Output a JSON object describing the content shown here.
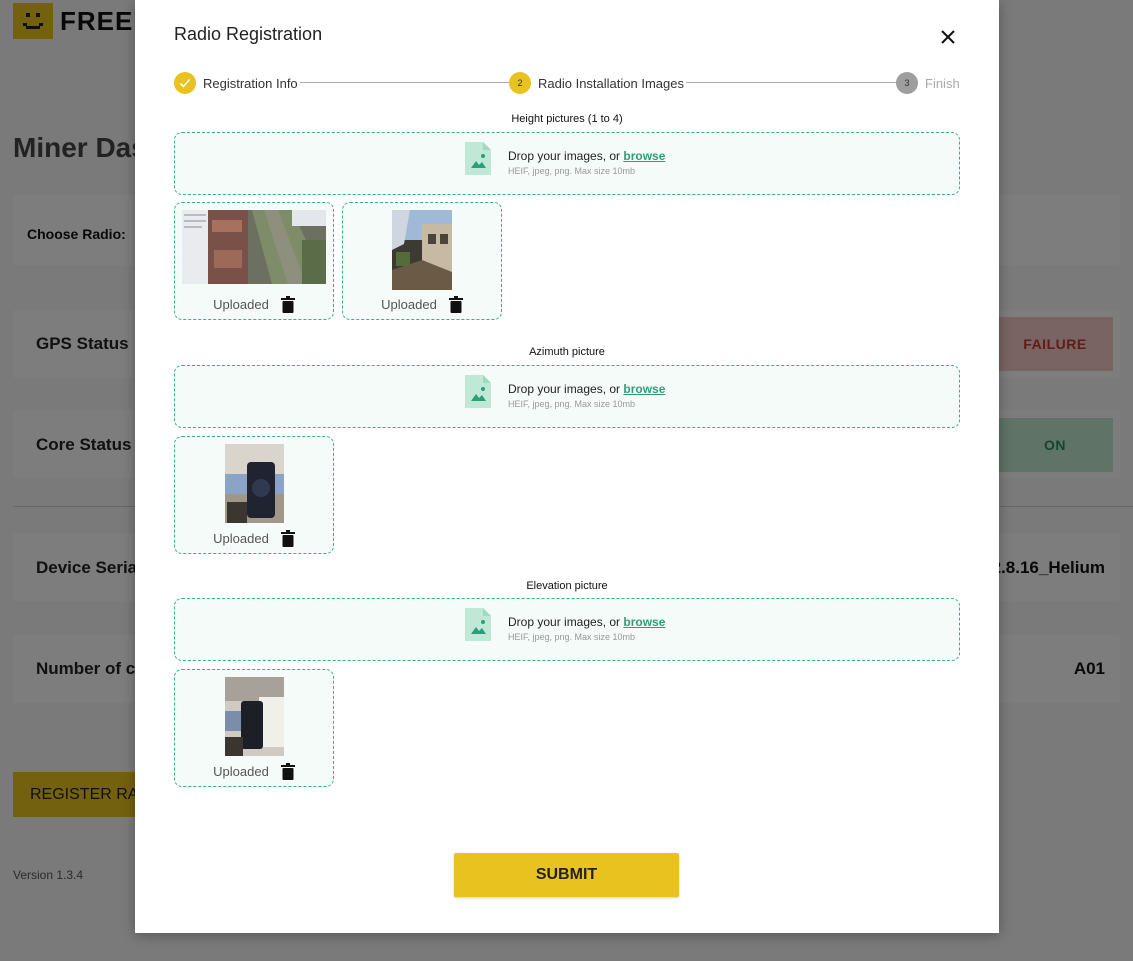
{
  "background": {
    "logo_text": "FREED",
    "page_title": "Miner Das",
    "choose_radio_label": "Choose Radio:",
    "gps_status_label": "GPS Status",
    "gps_status_value": "FAILURE",
    "core_status_label": "Core Status",
    "core_status_value": "ON",
    "device_serial_label": "Device Seria",
    "device_serial_value": "2.8.16_Helium",
    "number_label": "Number of c",
    "number_value": "A01",
    "register_button": "REGISTER RA",
    "version": "Version 1.3.4",
    "colors": {
      "brand": "#e8c21f",
      "failure_bg": "#f4c7c7",
      "on_bg": "#bfe6cf"
    }
  },
  "modal": {
    "title": "Radio Registration",
    "close_icon": "close-icon",
    "steps": [
      {
        "number": "",
        "label": "Registration Info",
        "state": "done"
      },
      {
        "number": "2",
        "label": "Radio Installation Images",
        "state": "active"
      },
      {
        "number": "3",
        "label": "Finish",
        "state": "pending"
      }
    ],
    "sections": [
      {
        "label": "Height pictures (1 to 4)",
        "drop_text": "Drop your images, or ",
        "browse_text": "browse",
        "hint": "HEIF, jpeg, png. Max size 10mb",
        "uploads": [
          {
            "status": "Uploaded"
          },
          {
            "status": "Uploaded"
          }
        ]
      },
      {
        "label": "Azimuth picture",
        "drop_text": "Drop your images, or ",
        "browse_text": "browse",
        "hint": "HEIF, jpeg, png. Max size 10mb",
        "uploads": [
          {
            "status": "Uploaded"
          }
        ]
      },
      {
        "label": "Elevation picture",
        "drop_text": "Drop your images, or ",
        "browse_text": "browse",
        "hint": "HEIF, jpeg, png. Max size 10mb",
        "uploads": [
          {
            "status": "Uploaded"
          }
        ]
      }
    ],
    "submit_label": "SUBMIT",
    "colors": {
      "accent": "#e8c21f",
      "dropzone_border": "#3aae8a",
      "link": "#2e9e7a"
    }
  }
}
